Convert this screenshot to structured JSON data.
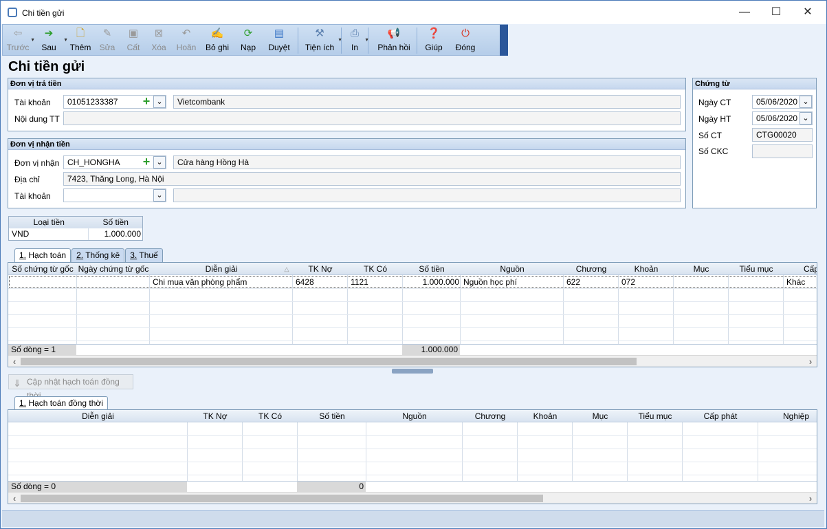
{
  "window": {
    "title": "Chi tiền gửi",
    "min": "—",
    "max": "☐",
    "close": "✕"
  },
  "toolbar": {
    "truoc": "Trước",
    "sau": "Sau",
    "them": "Thêm",
    "sua": "Sửa",
    "cat": "Cất",
    "xoa": "Xóa",
    "hoan": "Hoãn",
    "boghi": "Bỏ ghi",
    "nap": "Nạp",
    "duyet": "Duyệt",
    "tienich": "Tiện ích",
    "in": "In",
    "phanhoi": "Phản hồi",
    "giup": "Giúp",
    "dong": "Đóng"
  },
  "page_title": "Chi tiền gửi",
  "payer": {
    "header": "Đơn vị trả tiền",
    "account_label": "Tài khoản",
    "account_value": "01051233387",
    "bank_name": "Vietcombank",
    "content_label": "Nội dung TT",
    "content_value": ""
  },
  "payee": {
    "header": "Đơn vị nhận tiền",
    "unit_label": "Đơn vị nhận",
    "unit_code": "CH_HONGHA",
    "unit_name": "Cửa hàng Hồng Hà",
    "address_label": "Địa chỉ",
    "address_value": "7423, Thăng Long, Hà Nội",
    "account_label": "Tài khoản",
    "account_value": "",
    "account_name": ""
  },
  "voucher": {
    "header": "Chứng từ",
    "ngay_ct_label": "Ngày CT",
    "ngay_ct": "05/06/2020",
    "ngay_ht_label": "Ngày HT",
    "ngay_ht": "05/06/2020",
    "so_ct_label": "Số CT",
    "so_ct": "CTG00020",
    "so_ckc_label": "Số CKC",
    "so_ckc": ""
  },
  "currency": {
    "col_type": "Loại tiền",
    "col_amount": "Số tiền",
    "type": "VND",
    "amount": "1.000.000"
  },
  "tabs1": [
    {
      "num": "1.",
      "label": " Hạch toán"
    },
    {
      "num": "2.",
      "label": " Thống kê"
    },
    {
      "num": "3.",
      "label": " Thuế"
    }
  ],
  "grid1": {
    "columns": [
      "Số chứng từ gốc",
      "Ngày chứng từ gốc",
      "Diễn giải",
      "TK Nợ",
      "TK Có",
      "Số tiền",
      "Nguồn",
      "Chương",
      "Khoản",
      "Mục",
      "Tiểu mục",
      "Cấp"
    ],
    "rows": [
      {
        "dien_giai": "Chi mua văn phòng phẩm",
        "tk_no": "6428",
        "tk_co": "1121",
        "so_tien": "1.000.000",
        "nguon": "Nguồn học phí",
        "chuong": "622",
        "khoan": "072",
        "cap": "Khác"
      }
    ],
    "footer_count": "Số dòng = 1",
    "footer_total": "1.000.000"
  },
  "update_button": "Cập nhật hạch toán đồng thời",
  "tabs2": [
    {
      "num": "1.",
      "label": " Hạch toán đồng thời"
    }
  ],
  "grid2": {
    "columns": [
      "Diễn giải",
      "TK Nợ",
      "TK Có",
      "Số tiền",
      "Nguồn",
      "Chương",
      "Khoản",
      "Mục",
      "Tiểu mục",
      "Cấp phát",
      "Nghiệp"
    ],
    "footer_count": "Số dòng = 0",
    "footer_total": "0"
  }
}
